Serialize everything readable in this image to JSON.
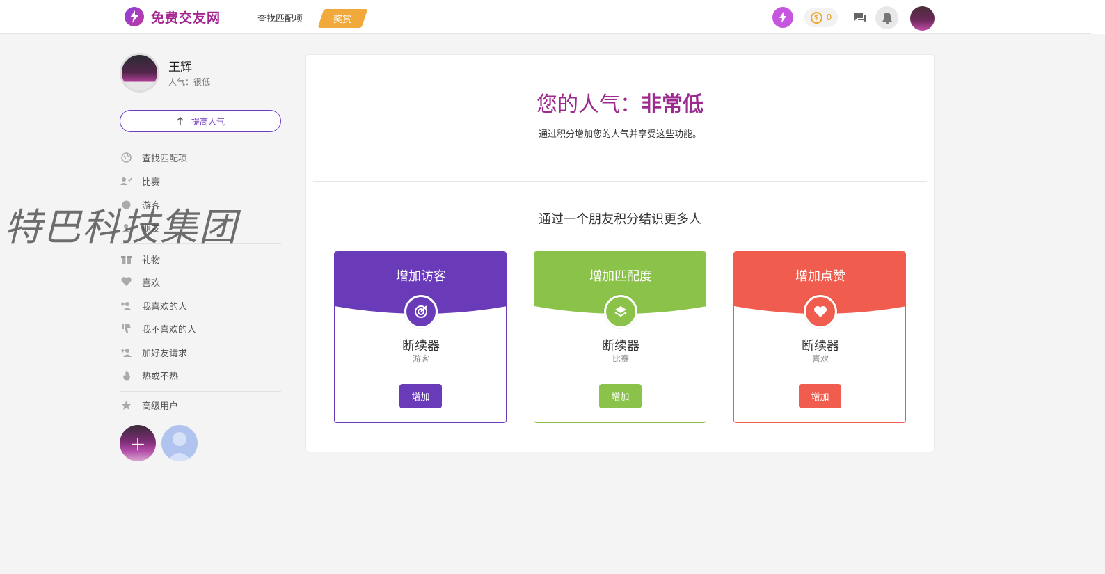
{
  "header": {
    "logo_text": "免费交友网",
    "nav_link": "查找匹配项",
    "nav_badge": "奖赏",
    "credits": "0",
    "coin_symbol": "$"
  },
  "profile": {
    "name": "王辉",
    "popularity": "人气：很低",
    "boost_label": "提高人气"
  },
  "menu": {
    "group1": [
      {
        "label": "查找匹配项",
        "icon": "globe-icon"
      },
      {
        "label": "比赛",
        "icon": "people-icon"
      },
      {
        "label": "游客",
        "icon": "eye-icon"
      },
      {
        "label": "朋友",
        "icon": "friends-icon"
      }
    ],
    "group2": [
      {
        "label": "礼物",
        "icon": "gift-icon"
      },
      {
        "label": "喜欢",
        "icon": "heart-icon"
      },
      {
        "label": "我喜欢的人",
        "icon": "user-plus-icon"
      },
      {
        "label": "我不喜欢的人",
        "icon": "thumbs-down-icon"
      },
      {
        "label": "加好友请求",
        "icon": "user-add-icon"
      },
      {
        "label": "热或不热",
        "icon": "fire-icon"
      }
    ],
    "group3": [
      {
        "label": "高级用户",
        "icon": "star-icon"
      }
    ],
    "add_symbol": "+"
  },
  "watermark": "特巴科技集团",
  "main": {
    "title_prefix": "您的人气：",
    "title_level": "非常低",
    "subtitle": "通过积分增加您的人气并享受这些功能。",
    "section_title": "通过一个朋友积分结识更多人",
    "cards": [
      {
        "title": "增加访客",
        "name": "断续器",
        "sub": "游客",
        "button": "增加",
        "color": "#6a3bb8",
        "icon": "target-icon"
      },
      {
        "title": "增加匹配度",
        "name": "断续器",
        "sub": "比赛",
        "button": "增加",
        "color": "#8bc34a",
        "icon": "layers-icon"
      },
      {
        "title": "增加点赞",
        "name": "断续器",
        "sub": "喜欢",
        "button": "增加",
        "color": "#f05d4f",
        "icon": "heart-icon"
      }
    ]
  }
}
